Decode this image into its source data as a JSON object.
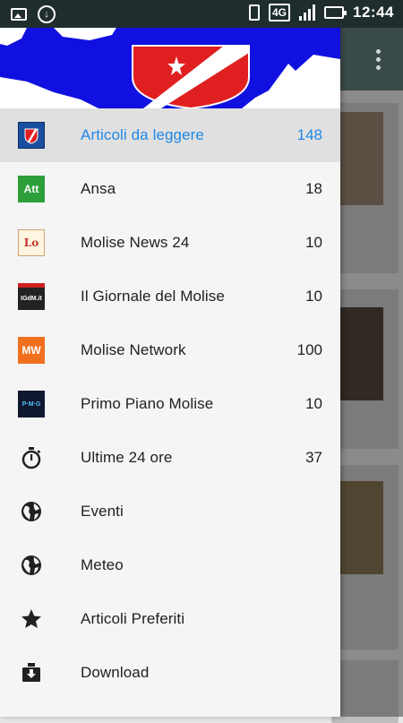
{
  "status_bar": {
    "time": "12:44",
    "network": "4G"
  },
  "drawer": {
    "items": [
      {
        "label": "Articoli da leggere",
        "count": "148",
        "icon": "molise-news-logo-icon",
        "active": true
      },
      {
        "label": "Ansa",
        "count": "18",
        "icon": "ansa-logo-icon"
      },
      {
        "label": "Molise News 24",
        "count": "10",
        "icon": "molise-news-24-logo-icon"
      },
      {
        "label": "Il Giornale del Molise",
        "count": "10",
        "icon": "giornale-del-molise-logo-icon"
      },
      {
        "label": "Molise Network",
        "count": "100",
        "icon": "molise-network-logo-icon"
      },
      {
        "label": "Primo Piano Molise",
        "count": "10",
        "icon": "primo-piano-molise-logo-icon"
      },
      {
        "label": "Ultime 24 ore",
        "count": "37",
        "icon": "stopwatch-icon"
      },
      {
        "label": "Eventi",
        "count": "",
        "icon": "globe-icon"
      },
      {
        "label": "Meteo",
        "count": "",
        "icon": "globe-icon"
      },
      {
        "label": "Articoli Preferiti",
        "count": "",
        "icon": "star-icon"
      },
      {
        "label": "Download",
        "count": "",
        "icon": "download-icon"
      }
    ]
  },
  "colors": {
    "accent": "#1e88e5",
    "header_blue": "#1010e0",
    "flag_red": "#e02020"
  },
  "icon_texts": {
    "ansa": "Att",
    "mn24": "Lo",
    "gdm": "IGdM.it",
    "mnet": "MW",
    "ppm": "P·M·G"
  }
}
